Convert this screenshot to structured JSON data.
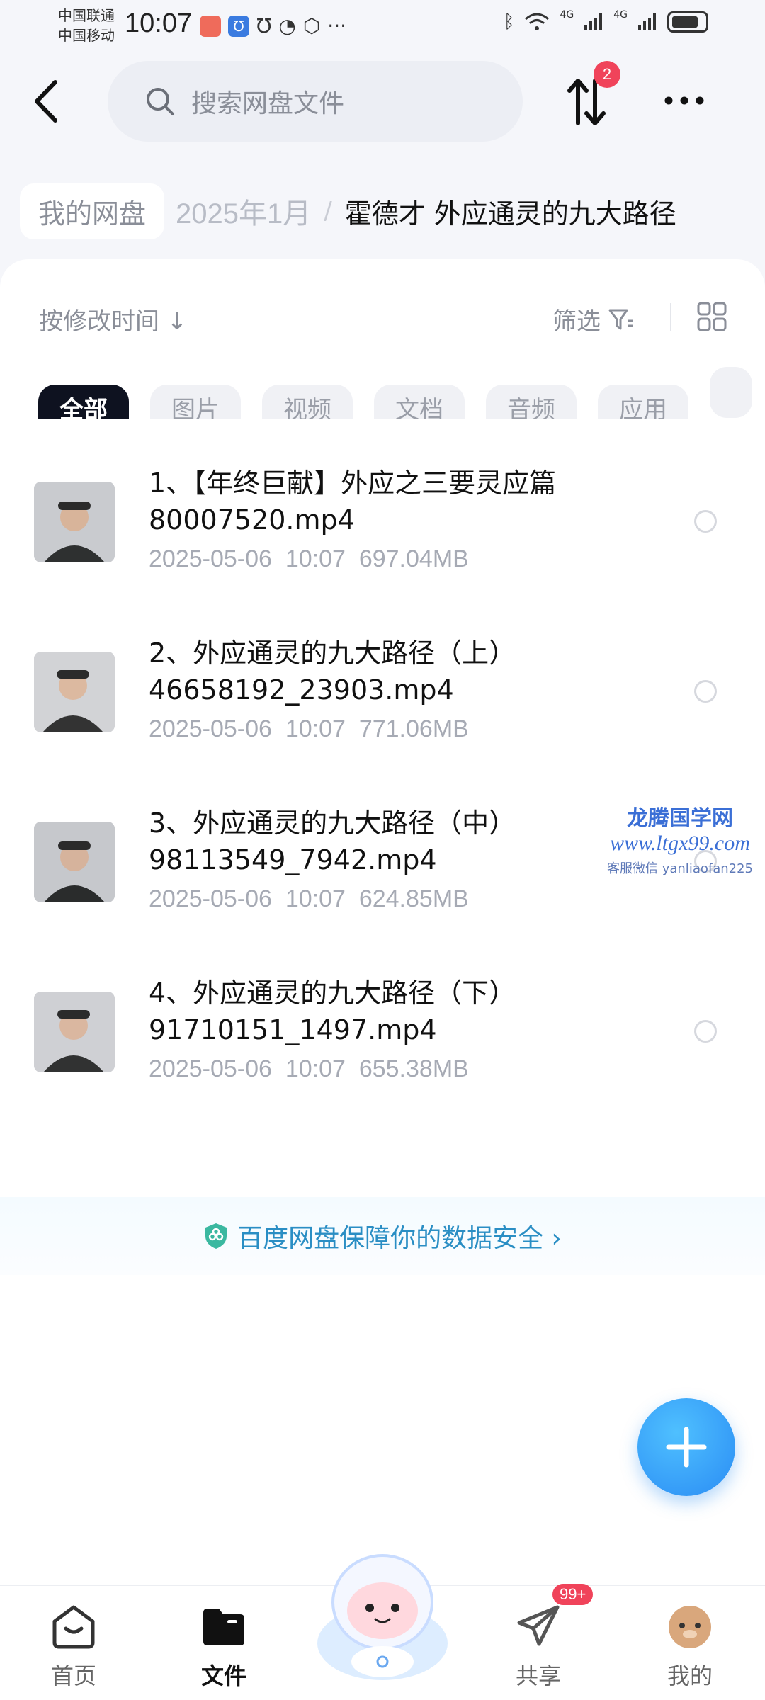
{
  "status_bar": {
    "carrier1": "中国联通",
    "carrier2": "中国移动",
    "time": "10:07",
    "net1": "4G",
    "net2": "4G"
  },
  "search": {
    "placeholder": "搜索网盘文件"
  },
  "transfer_badge": "2",
  "breadcrumb": {
    "root": "我的网盘",
    "mid": "2025年1月",
    "separator": "/",
    "current": "霍德才 外应通灵的九大路径"
  },
  "toolbar": {
    "sort_label": "按修改时间 ↓",
    "filter_label": "筛选"
  },
  "chips": [
    "全部",
    "图片",
    "视频",
    "文档",
    "音频",
    "应用"
  ],
  "files": [
    {
      "line1": "1、【年终巨献】外应之三要灵应篇",
      "line2": "80007520.mp4",
      "date": "2025-05-06",
      "time": "10:07",
      "size": "697.04MB"
    },
    {
      "line1": "2、外应通灵的九大路径（上）",
      "line2": "46658192_23903.mp4",
      "date": "2025-05-06",
      "time": "10:07",
      "size": "771.06MB"
    },
    {
      "line1": "3、外应通灵的九大路径（中）",
      "line2": "98113549_7942.mp4",
      "date": "2025-05-06",
      "time": "10:07",
      "size": "624.85MB"
    },
    {
      "line1": "4、外应通灵的九大路径（下）",
      "line2": "91710151_1497.mp4",
      "date": "2025-05-06",
      "time": "10:07",
      "size": "655.38MB"
    }
  ],
  "watermark": {
    "name": "龙腾国学网",
    "url": "www.ltgx99.com",
    "contact": "客服微信 yanliaofan225"
  },
  "security_text": "百度网盘保障你的数据安全 ›",
  "bottom_nav": [
    {
      "label": "首页",
      "icon": "home-icon",
      "active": false
    },
    {
      "label": "文件",
      "icon": "folder-icon",
      "active": true
    },
    {
      "label": "共享",
      "icon": "share-icon",
      "active": false
    },
    {
      "label": "我的",
      "icon": "avatar-icon",
      "active": false
    }
  ],
  "share_badge": "99+",
  "colors": {
    "accent": "#2a8cf4",
    "badge": "#f0435a",
    "active_chip": "#0e1220"
  }
}
